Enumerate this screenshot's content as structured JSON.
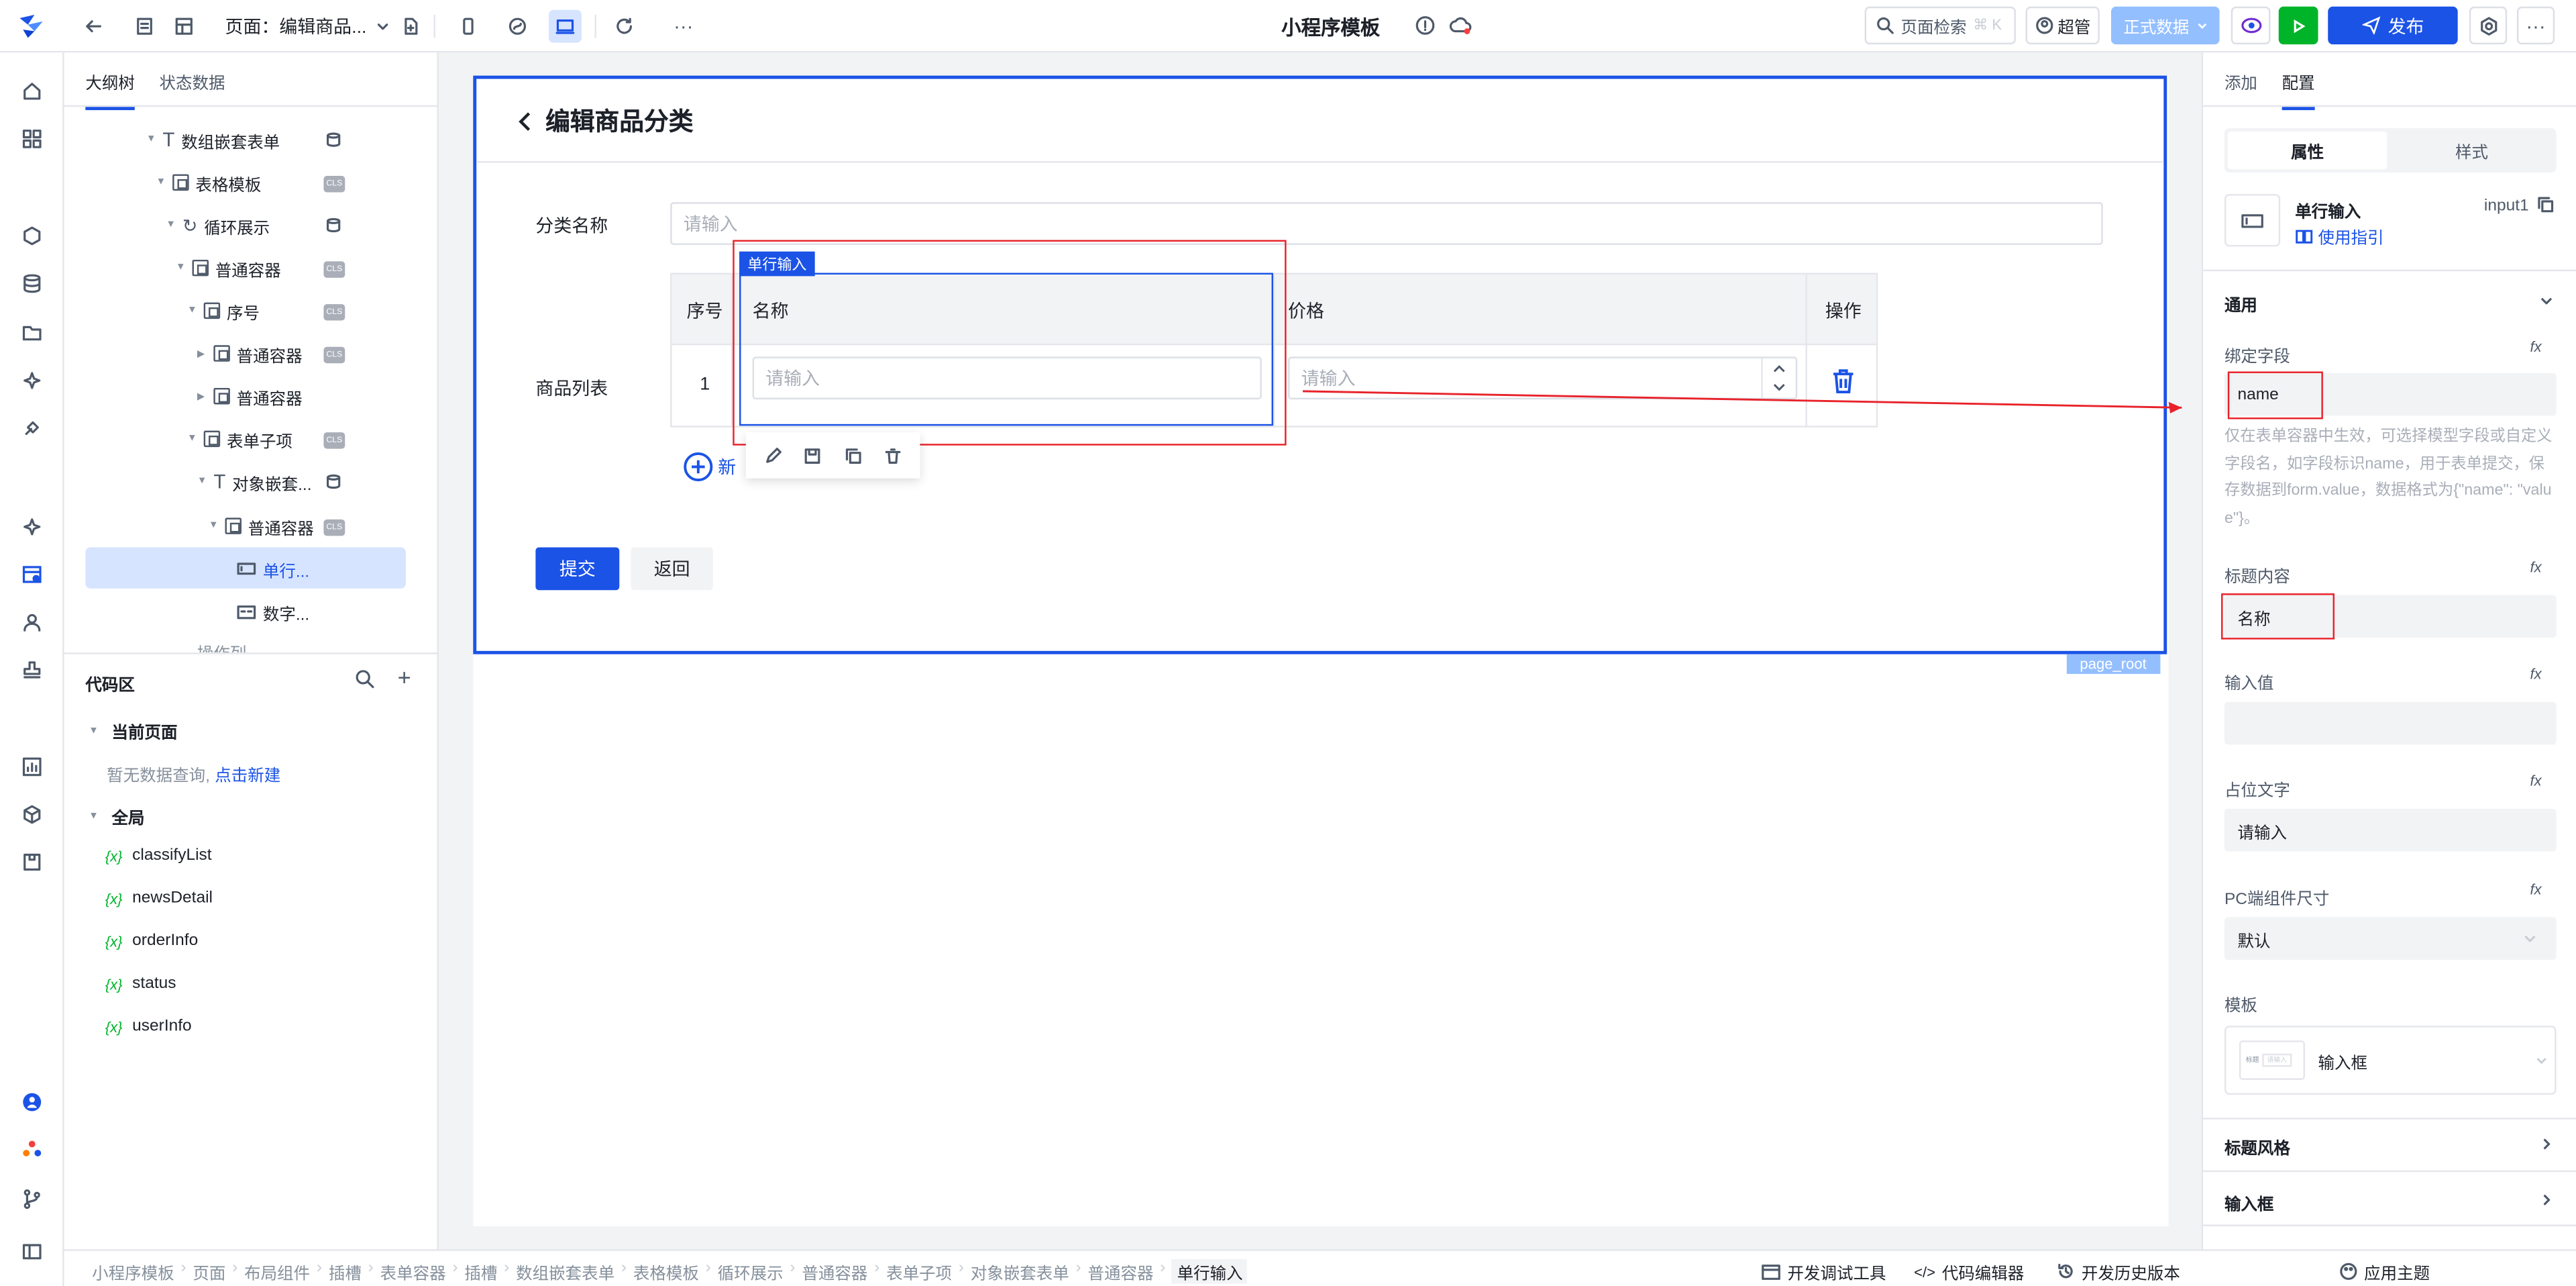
{
  "topbar": {
    "page_prefix": "页面：编辑商品...",
    "app_title": "小程序模板",
    "search_label": "页面检索",
    "search_shortcut": "⌘ K",
    "user": "超管",
    "env": "正式数据",
    "publish": "发布"
  },
  "outline": {
    "tabs": [
      "大纲树",
      "状态数据"
    ],
    "nodes": [
      {
        "label": "数组嵌套表单"
      },
      {
        "label": "表格模板"
      },
      {
        "label": "循环展示"
      },
      {
        "label": "普通容器"
      },
      {
        "label": "序号"
      },
      {
        "label": "普通容器"
      },
      {
        "label": "普通容器"
      },
      {
        "label": "表单子项"
      },
      {
        "label": "对象嵌套..."
      },
      {
        "label": "普通容器"
      },
      {
        "label": "单行..."
      },
      {
        "label": "数字..."
      },
      {
        "label": "操作列"
      }
    ]
  },
  "code": {
    "title": "代码区",
    "current_page": "当前页面",
    "empty_text": "暂无数据查询,",
    "create_link": "点击新建",
    "global": "全局",
    "vars": [
      "classifyList",
      "newsDetail",
      "orderInfo",
      "status",
      "userInfo"
    ],
    "var_prefix": "{x}"
  },
  "canvas": {
    "page_title": "编辑商品分类",
    "field_category_label": "分类名称",
    "placeholder": "请输入",
    "list_label": "商品列表",
    "col_index": "序号",
    "col_name": "名称",
    "col_price": "价格",
    "col_op": "操作",
    "row_index": "1",
    "add_label": "新",
    "submit": "提交",
    "back": "返回",
    "selected_tag": "单行输入",
    "root_tag": "page_root"
  },
  "props": {
    "tabs": [
      "添加",
      "配置"
    ],
    "seg": [
      "属性",
      "样式"
    ],
    "component_name": "单行输入",
    "component_id": "input1",
    "guide": "使用指引",
    "section_general": "通用",
    "bind_field_label": "绑定字段",
    "bind_field_value": "name",
    "bind_help": "仅在表单容器中生效，可选择模型字段或自定义字段名，如字段标识name，用于表单提交，保存数据到form.value，数据格式为{\"name\": \"value\"}。",
    "title_label": "标题内容",
    "title_value": "名称",
    "value_label": "输入值",
    "placeholder_label": "占位文字",
    "placeholder_value": "请输入",
    "size_label": "PC端组件尺寸",
    "size_value": "默认",
    "template_label": "模板",
    "template_value": "输入框",
    "template_thumb_left": "标题",
    "template_thumb_right": "请输入",
    "section_title_style": "标题风格",
    "section_input": "输入框",
    "fx": "fx"
  },
  "footer": {
    "breadcrumbs": [
      "小程序模板",
      "页面",
      "布局组件",
      "插槽",
      "表单容器",
      "插槽",
      "数组嵌套表单",
      "表格模板",
      "循环展示",
      "普通容器",
      "表单子项",
      "对象嵌套表单",
      "普通容器",
      "单行输入"
    ],
    "debug": "开发调试工具",
    "code_editor": "代码编辑器",
    "history": "开发历史版本",
    "theme": "应用主题"
  },
  "colors": {
    "primary": "#1b53e6",
    "annotation": "#e8222a"
  }
}
